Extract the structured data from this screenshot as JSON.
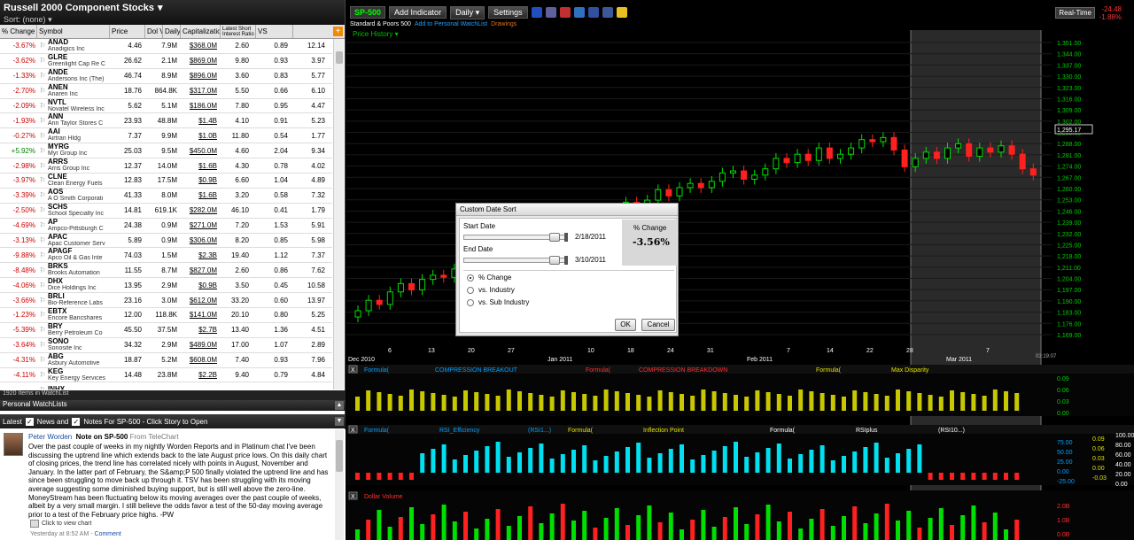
{
  "watchlist": {
    "title": "Russell 2000 Component Stocks",
    "sort_label": "Sort:",
    "sort_value": "(none)",
    "columns": [
      "% Change",
      "Symbol",
      "Price",
      "Dol Vol",
      "Daily",
      "Capitalization",
      "Latest Short Interest Ratio",
      "VS"
    ],
    "rows": [
      {
        "pc": "-3.67%",
        "sym": "ANAD",
        "name": "Anadigics Inc",
        "price": "4.46",
        "dv": "7.9M",
        "cap": "$368.0M",
        "si": "2.60",
        "vs": "0.89",
        "last": "12.14"
      },
      {
        "pc": "-3.62%",
        "sym": "GLRE",
        "name": "Greenlight Cap Re C",
        "price": "26.62",
        "dv": "2.1M",
        "cap": "$869.0M",
        "si": "9.80",
        "vs": "0.93",
        "last": "3.97"
      },
      {
        "pc": "-1.33%",
        "sym": "ANDE",
        "name": "Andersons Inc (The)",
        "price": "46.74",
        "dv": "8.9M",
        "cap": "$896.0M",
        "si": "3.60",
        "vs": "0.83",
        "last": "5.77"
      },
      {
        "pc": "-2.70%",
        "sym": "ANEN",
        "name": "Anaren Inc",
        "price": "18.76",
        "dv": "864.8K",
        "cap": "$317.0M",
        "si": "5.50",
        "vs": "0.66",
        "last": "6.10"
      },
      {
        "pc": "-2.09%",
        "sym": "NVTL",
        "name": "Novatel Wireless Inc",
        "price": "5.62",
        "dv": "5.1M",
        "cap": "$186.0M",
        "si": "7.80",
        "vs": "0.95",
        "last": "4.47"
      },
      {
        "pc": "-1.93%",
        "sym": "ANN",
        "name": "Ann Taylor Stores C",
        "price": "23.93",
        "dv": "48.8M",
        "cap": "$1.4B",
        "si": "4.10",
        "vs": "0.91",
        "last": "5.23"
      },
      {
        "pc": "-0.27%",
        "sym": "AAI",
        "name": "Airtran Hldg",
        "price": "7.37",
        "dv": "9.9M",
        "cap": "$1.0B",
        "si": "11.80",
        "vs": "0.54",
        "last": "1.77"
      },
      {
        "pc": "+5.92%",
        "sym": "MYRG",
        "name": "Myr Group Inc",
        "price": "25.03",
        "dv": "9.5M",
        "cap": "$450.0M",
        "si": "4.60",
        "vs": "2.04",
        "last": "9.34"
      },
      {
        "pc": "-2.98%",
        "sym": "ARRS",
        "name": "Arris Group Inc",
        "price": "12.37",
        "dv": "14.0M",
        "cap": "$1.6B",
        "si": "4.30",
        "vs": "0.78",
        "last": "4.02"
      },
      {
        "pc": "-3.97%",
        "sym": "CLNE",
        "name": "Clean Energy Fuels",
        "price": "12.83",
        "dv": "17.5M",
        "cap": "$0.9B",
        "si": "6.60",
        "vs": "1.04",
        "last": "4.89"
      },
      {
        "pc": "-3.39%",
        "sym": "AOS",
        "name": "A O Smith Corporati",
        "price": "41.33",
        "dv": "8.0M",
        "cap": "$1.6B",
        "si": "3.20",
        "vs": "0.58",
        "last": "7.32"
      },
      {
        "pc": "-2.50%",
        "sym": "SCHS",
        "name": "School Specialty Inc",
        "price": "14.81",
        "dv": "619.1K",
        "cap": "$282.0M",
        "si": "46.10",
        "vs": "0.41",
        "last": "1.79"
      },
      {
        "pc": "-4.69%",
        "sym": "AP",
        "name": "Ampco-Pittsburgh C",
        "price": "24.38",
        "dv": "0.9M",
        "cap": "$271.0M",
        "si": "7.20",
        "vs": "1.53",
        "last": "5.91"
      },
      {
        "pc": "-3.13%",
        "sym": "APAC",
        "name": "Apac Customer Serv",
        "price": "5.89",
        "dv": "0.9M",
        "cap": "$306.0M",
        "si": "8.20",
        "vs": "0.85",
        "last": "5.98"
      },
      {
        "pc": "-9.88%",
        "sym": "APAGF",
        "name": "Apco Oil & Gas Inte",
        "price": "74.03",
        "dv": "1.5M",
        "cap": "$2.3B",
        "si": "19.40",
        "vs": "1.12",
        "last": "7.37"
      },
      {
        "pc": "-8.48%",
        "sym": "BRKS",
        "name": "Brooks Automation",
        "price": "11.55",
        "dv": "8.7M",
        "cap": "$827.0M",
        "si": "2.60",
        "vs": "0.86",
        "last": "7.62"
      },
      {
        "pc": "-4.06%",
        "sym": "DHX",
        "name": "Dice Holdings Inc",
        "price": "13.95",
        "dv": "2.9M",
        "cap": "$0.9B",
        "si": "3.50",
        "vs": "0.45",
        "last": "10.58"
      },
      {
        "pc": "-3.66%",
        "sym": "BRLI",
        "name": "Bio-Reference Labs",
        "price": "23.16",
        "dv": "3.0M",
        "cap": "$612.0M",
        "si": "33.20",
        "vs": "0.60",
        "last": "13.97"
      },
      {
        "pc": "-1.23%",
        "sym": "EBTX",
        "name": "Encore Bancshares",
        "price": "12.00",
        "dv": "118.8K",
        "cap": "$141.0M",
        "si": "20.10",
        "vs": "0.80",
        "last": "5.25"
      },
      {
        "pc": "-5.39%",
        "sym": "BRY",
        "name": "Berry Petroleum Co",
        "price": "45.50",
        "dv": "37.5M",
        "cap": "$2.7B",
        "si": "13.40",
        "vs": "1.36",
        "last": "4.51"
      },
      {
        "pc": "-3.64%",
        "sym": "SONO",
        "name": "Sonosite Inc",
        "price": "34.32",
        "dv": "2.9M",
        "cap": "$489.0M",
        "si": "17.00",
        "vs": "1.07",
        "last": "2.89"
      },
      {
        "pc": "-4.31%",
        "sym": "ABG",
        "name": "Asbury Automotive",
        "price": "18.87",
        "dv": "5.2M",
        "cap": "$608.0M",
        "si": "7.40",
        "vs": "0.93",
        "last": "7.96"
      },
      {
        "pc": "-4.11%",
        "sym": "KEG",
        "name": "Key Energy Services",
        "price": "14.48",
        "dv": "23.8M",
        "cap": "$2.2B",
        "si": "9.40",
        "vs": "0.79",
        "last": "4.84"
      },
      {
        "pc": "",
        "sym": "INHX",
        "name": "",
        "price": "",
        "dv": "",
        "cap": "",
        "si": "",
        "vs": "",
        "last": ""
      }
    ],
    "status": "1920 Items in WatchList",
    "personal_label": "Personal WatchLists"
  },
  "news": {
    "latest_label": "Latest",
    "news_label": "News and",
    "notes_label": "Notes For SP-500 - Click Story to Open",
    "author": "Peter Worden",
    "title": "Note on SP-500",
    "from": "From TeleChart",
    "body": "Over the past couple of weeks in my nightly Worden Reports and in Platinum chat I've been discussing the uptrend line which extends back to the late August price lows. On this daily chart of closing prices, the trend line has correlated nicely with points in August, November and January. In the latter part of February, the S&amp;P 500 finally violated the uptrend line and has since been struggling to move back up through it. TSV has been struggling with its moving average suggesting some diminished buying support, but is still well above the zero-line. MoneyStream has been fluctuating below its moving averages over the past couple of weeks, albeit by a very small margin. I still believe the odds favor a test of the 50-day moving average prior to a test of the February price highs. -PW",
    "view_chart": "Click to view chart",
    "timestamp": "Yesterday at 8:52 AM -",
    "comment": "Comment"
  },
  "chart": {
    "symbol": "SP-500",
    "add_indicator": "Add Indicator",
    "period": "Daily",
    "settings": "Settings",
    "realtime": "Real-Time",
    "change1": "-24.48",
    "change2": "-1.88%",
    "name": "Standard & Poors 500",
    "add_watch": "Add to Personal WatchList",
    "drawings": "Drawings",
    "price_history": "Price History",
    "current_price": "1,295.17",
    "time": "03:19:07",
    "price_ticks": [
      "1,351.00",
      "1,344.00",
      "1,337.00",
      "1,330.00",
      "1,323.00",
      "1,316.00",
      "1,309.00",
      "1,302.00",
      "1,295.00",
      "1,288.00",
      "1,281.00",
      "1,274.00",
      "1,267.00",
      "1,260.00",
      "1,253.00",
      "1,246.00",
      "1,239.00",
      "1,232.00",
      "1,225.00",
      "1,218.00",
      "1,211.00",
      "1,204.00",
      "1,197.00",
      "1,190.00",
      "1,183.00",
      "1,176.00",
      "1,169.00"
    ],
    "date_labels": [
      "Dec 2010",
      "6",
      "13",
      "20",
      "27",
      "Jan 2011",
      "10",
      "18",
      "24",
      "31",
      "Feb 2011",
      "7",
      "14",
      "22",
      "28",
      "Mar 2011",
      "7"
    ],
    "ind1": {
      "f1": "Formula(",
      "n1": "COMPRESSION BREAKOUT",
      "f2": "Formula(",
      "n2": "COMPRESSION BREAKDOWN",
      "f3": "Formula(",
      "n3": "Max Disparity",
      "ticks": [
        "0.09",
        "0.06",
        "0.03",
        "0.00"
      ],
      "box1": "1.50",
      "box2": "0.54",
      "box3": "-1.50",
      "box4": "0.00",
      "box5": "0.00"
    },
    "ind2": {
      "f1": "Formula(",
      "n1": "RSI_Efficiency",
      "p1": "(RSI1...)",
      "f2": "Formula(",
      "n2": "Inflection Point",
      "f3": "Formula(",
      "n3": "RSIplus",
      "p3": "(RSI10...)",
      "ticks": [
        "75.00",
        "50.00",
        "25.00",
        "0.00",
        "-25.00"
      ],
      "ticks2": [
        "0.09",
        "0.06",
        "0.03",
        "0.00",
        "-0.03"
      ],
      "ticks3": [
        "100.00",
        "80.00",
        "60.00",
        "40.00",
        "20.00",
        "0.00"
      ],
      "box1": "-8.69",
      "box2": "0.00"
    },
    "ind3": {
      "name": "Dollar Volume",
      "ticks": [
        "2.0B",
        "1.0B",
        "0.0B"
      ]
    }
  },
  "dialog": {
    "title": "Custom Date Sort",
    "start_label": "Start Date",
    "start_value": "2/18/2011",
    "end_label": "End Date",
    "end_value": "3/10/2011",
    "result_label": "% Change",
    "result_value": "-3.56%",
    "opt1": "% Change",
    "opt2": "vs. Industry",
    "opt3": "vs. Sub Industry",
    "ok": "OK",
    "cancel": "Cancel"
  },
  "colors": {
    "up": "#00e000",
    "down": "#ff2020",
    "olive": "#c8c800",
    "cyan": "#00e0f0"
  }
}
